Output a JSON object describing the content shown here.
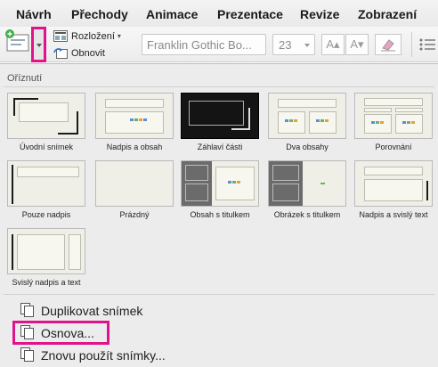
{
  "tabs": [
    "Návrh",
    "Přechody",
    "Animace",
    "Prezentace",
    "Revize",
    "Zobrazení"
  ],
  "ribbon": {
    "layout_label": "Rozložení",
    "reset_label": "Obnovit",
    "font_name": "Franklin Gothic Bo...",
    "font_size": "23",
    "grow_font": "A▴",
    "shrink_font": "A▾",
    "clear_format": "clear-format-icon"
  },
  "panel": {
    "section_title": "Oříznutí",
    "layouts": [
      {
        "label": "Úvodní snímek",
        "icon": "title-slide-layout",
        "selected": false
      },
      {
        "label": "Nadpis a obsah",
        "icon": "title-content-layout",
        "selected": false
      },
      {
        "label": "Záhlaví části",
        "icon": "section-header-layout",
        "selected": true
      },
      {
        "label": "Dva obsahy",
        "icon": "two-content-layout",
        "selected": false
      },
      {
        "label": "Porovnání",
        "icon": "comparison-layout",
        "selected": false
      },
      {
        "label": "Pouze nadpis",
        "icon": "title-only-layout",
        "selected": false
      },
      {
        "label": "Prázdný",
        "icon": "blank-layout",
        "selected": false
      },
      {
        "label": "Obsah s titulkem",
        "icon": "content-caption-layout",
        "selected": false
      },
      {
        "label": "Obrázek s titulkem",
        "icon": "picture-caption-layout",
        "selected": false
      },
      {
        "label": "Nadpis a svislý text",
        "icon": "title-vertical-text-layout",
        "selected": false
      },
      {
        "label": "Svislý nadpis a text",
        "icon": "vertical-title-text-layout",
        "selected": false
      }
    ],
    "menu": [
      {
        "label": "Duplikovat snímek",
        "icon": "duplicate-slide-icon"
      },
      {
        "label": "Osnova...",
        "icon": "outline-icon"
      },
      {
        "label": "Znovu použít snímky...",
        "icon": "reuse-slides-icon"
      }
    ]
  },
  "colors": {
    "highlight": "#e0138c",
    "accent": "#1b1b1b"
  }
}
